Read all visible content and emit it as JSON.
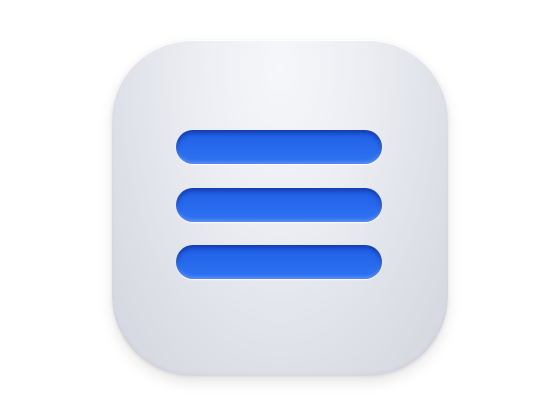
{
  "app_icon": {
    "icon": "menu-lines-icon",
    "bar_count": 3,
    "colors": {
      "bar_top": "#1f5fe6",
      "bar_bottom": "#2f73f2",
      "plate_light": "#f3f4f7",
      "plate_dark": "#d3d6de",
      "background": "#ffffff"
    }
  }
}
